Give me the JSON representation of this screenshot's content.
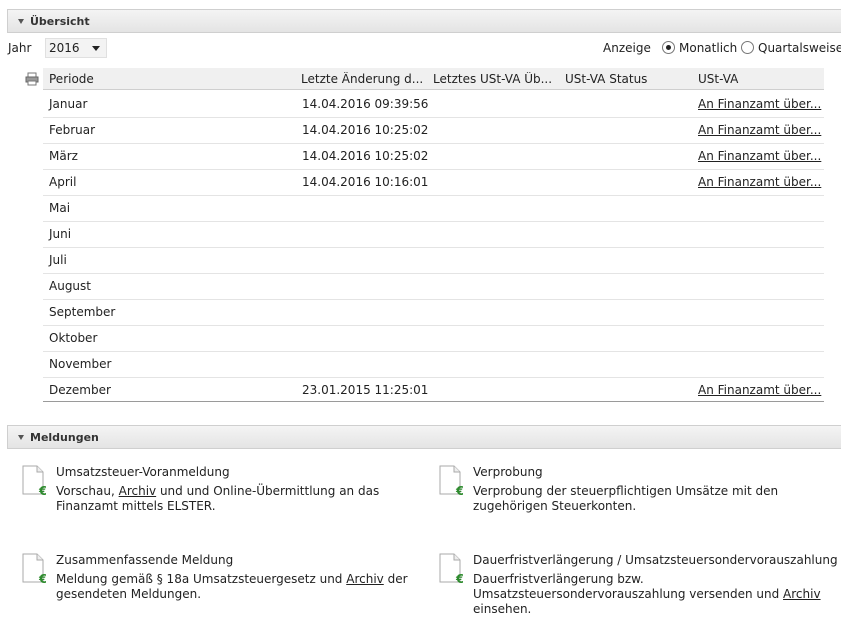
{
  "uebersicht": {
    "title": "Übersicht",
    "jahr_label": "Jahr",
    "jahr_value": "2016",
    "anzeige_label": "Anzeige",
    "radio_monatlich": "Monatlich",
    "radio_quartalsweise": "Quartalsweise",
    "selected_view": "Monatlich"
  },
  "table": {
    "headers": [
      "Periode",
      "Letzte Änderung d...",
      "Letztes USt-VA Üb...",
      "USt-VA Status",
      "USt-VA"
    ],
    "rows": [
      {
        "periode": "Januar",
        "aenderung": "14.04.2016 09:39:56",
        "ustva": "An Finanzamt über..."
      },
      {
        "periode": "Februar",
        "aenderung": "14.04.2016 10:25:02",
        "ustva": "An Finanzamt über..."
      },
      {
        "periode": "März",
        "aenderung": "14.04.2016 10:25:02",
        "ustva": "An Finanzamt über..."
      },
      {
        "periode": "April",
        "aenderung": "14.04.2016 10:16:01",
        "ustva": "An Finanzamt über..."
      },
      {
        "periode": "Mai",
        "aenderung": "",
        "ustva": ""
      },
      {
        "periode": "Juni",
        "aenderung": "",
        "ustva": ""
      },
      {
        "periode": "Juli",
        "aenderung": "",
        "ustva": ""
      },
      {
        "periode": "August",
        "aenderung": "",
        "ustva": ""
      },
      {
        "periode": "September",
        "aenderung": "",
        "ustva": ""
      },
      {
        "periode": "Oktober",
        "aenderung": "",
        "ustva": ""
      },
      {
        "periode": "November",
        "aenderung": "",
        "ustva": ""
      },
      {
        "periode": "Dezember",
        "aenderung": "23.01.2015 11:25:01",
        "ustva": "An Finanzamt über..."
      }
    ]
  },
  "meldungen": {
    "title": "Meldungen",
    "items": [
      {
        "title": "Umsatzsteuer-Voranmeldung",
        "desc_parts": [
          "Vorschau, ",
          "Archiv",
          " und und Online-Übermittlung an das Finanzamt mittels ELSTER."
        ]
      },
      {
        "title": "Verprobung",
        "desc_parts": [
          "Verprobung der steuerpflichtigen Umsätze mit den zugehörigen Steuerkonten.",
          "",
          ""
        ]
      },
      {
        "title": "Zusammenfassende Meldung",
        "desc_parts": [
          "Meldung gemäß § 18a Umsatzsteuergesetz und ",
          "Archiv",
          " der gesendeten Meldungen."
        ]
      },
      {
        "title": "Dauerfristverlängerung / Umsatzsteuersondervorauszahlung",
        "desc_parts": [
          "Dauerfristverlängerung bzw. Umsatzsteuersondervorauszahlung versenden und ",
          "Archiv",
          " einsehen."
        ]
      }
    ]
  },
  "icons": {
    "collapse": "triangle-down-icon",
    "print": "printer-icon",
    "document_euro": "document-euro-icon"
  },
  "colors": {
    "euro_green": "#2e8b2e",
    "header_bg": "#e8e8e8"
  }
}
